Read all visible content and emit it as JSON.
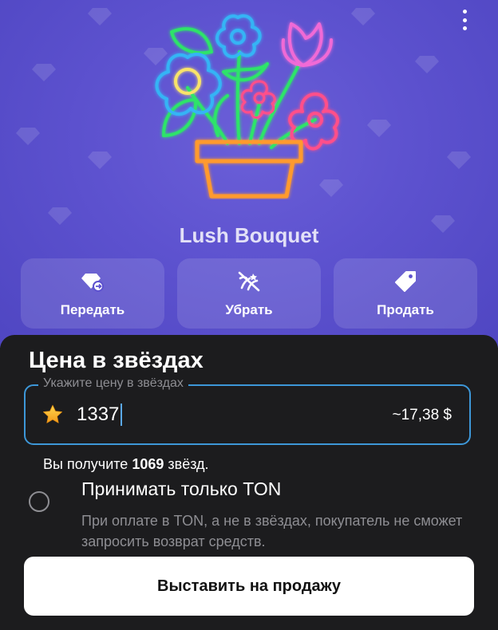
{
  "gift": {
    "name": "Lush Bouquet"
  },
  "header": {
    "menu_icon": "more-vertical-icon"
  },
  "actions": [
    {
      "label": "Передать",
      "icon": "diamond-transfer-icon"
    },
    {
      "label": "Убрать",
      "icon": "hide-icon"
    },
    {
      "label": "Продать",
      "icon": "price-tag-icon"
    }
  ],
  "sheet": {
    "title": "Цена в звёздах",
    "price_field": {
      "placeholder": "Укажите цену в звёздах",
      "value": "1337",
      "usd_estimate": "~17,38 $",
      "icon": "star-icon"
    },
    "receive": {
      "prefix": "Вы получите",
      "amount": "1069",
      "suffix": "звёзд."
    },
    "ton_option": {
      "title": "Принимать только TON",
      "description": "При оплате в TON, а не в звёздах, покупатель не сможет запросить возврат средств.",
      "checked": false
    },
    "submit_label": "Выставить на продажу"
  },
  "colors": {
    "hero_background": "#5d52cf",
    "field_border": "#3d97d8",
    "sheet_background": "#1c1c1e",
    "star": "#f5b82e"
  }
}
